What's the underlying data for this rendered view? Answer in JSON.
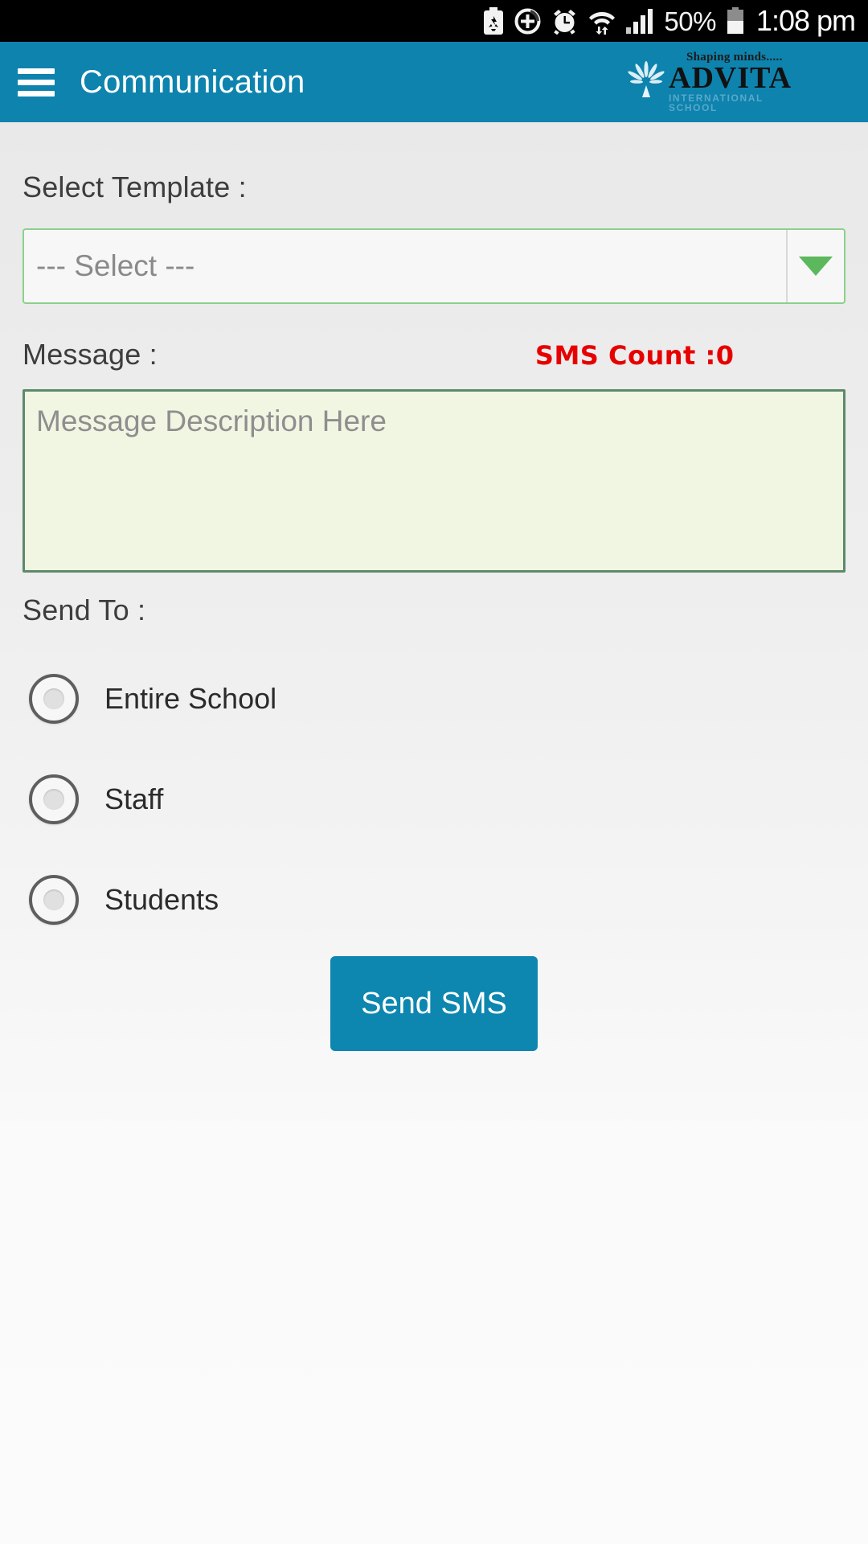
{
  "status_bar": {
    "icons": [
      "power-saving-battery-icon",
      "data-saver-plus-icon",
      "alarm-clock-icon",
      "wifi-transfer-icon",
      "cellular-signal-icon"
    ],
    "battery_percent": "50%",
    "battery_icon": "battery-half-icon",
    "time": "1:08 pm"
  },
  "app_bar": {
    "menu_icon": "hamburger-menu-icon",
    "title": "Communication",
    "logo": {
      "tagline": "Shaping minds.....",
      "name": "ADVITA",
      "subtitle": "INTERNATIONAL SCHOOL"
    }
  },
  "form": {
    "template": {
      "label": "Select Template :",
      "selected_value": "--- Select ---",
      "arrow_icon": "chevron-down-icon"
    },
    "message": {
      "label": "Message :",
      "sms_count_label": "SMS Count :0",
      "value": "",
      "placeholder": "Message Description Here"
    },
    "send_to": {
      "label": "Send To :",
      "options": [
        {
          "label": "Entire School",
          "selected": false
        },
        {
          "label": "Staff",
          "selected": false
        },
        {
          "label": "Students",
          "selected": false
        }
      ]
    },
    "submit_label": "Send SMS"
  },
  "colors": {
    "app_bar": "#0d83ae",
    "button": "#0d86b0",
    "select_border": "#8bd08b",
    "textarea_border": "#5c8a6a",
    "textarea_bg": "#f1f6e3",
    "sms_count": "#e60000"
  }
}
